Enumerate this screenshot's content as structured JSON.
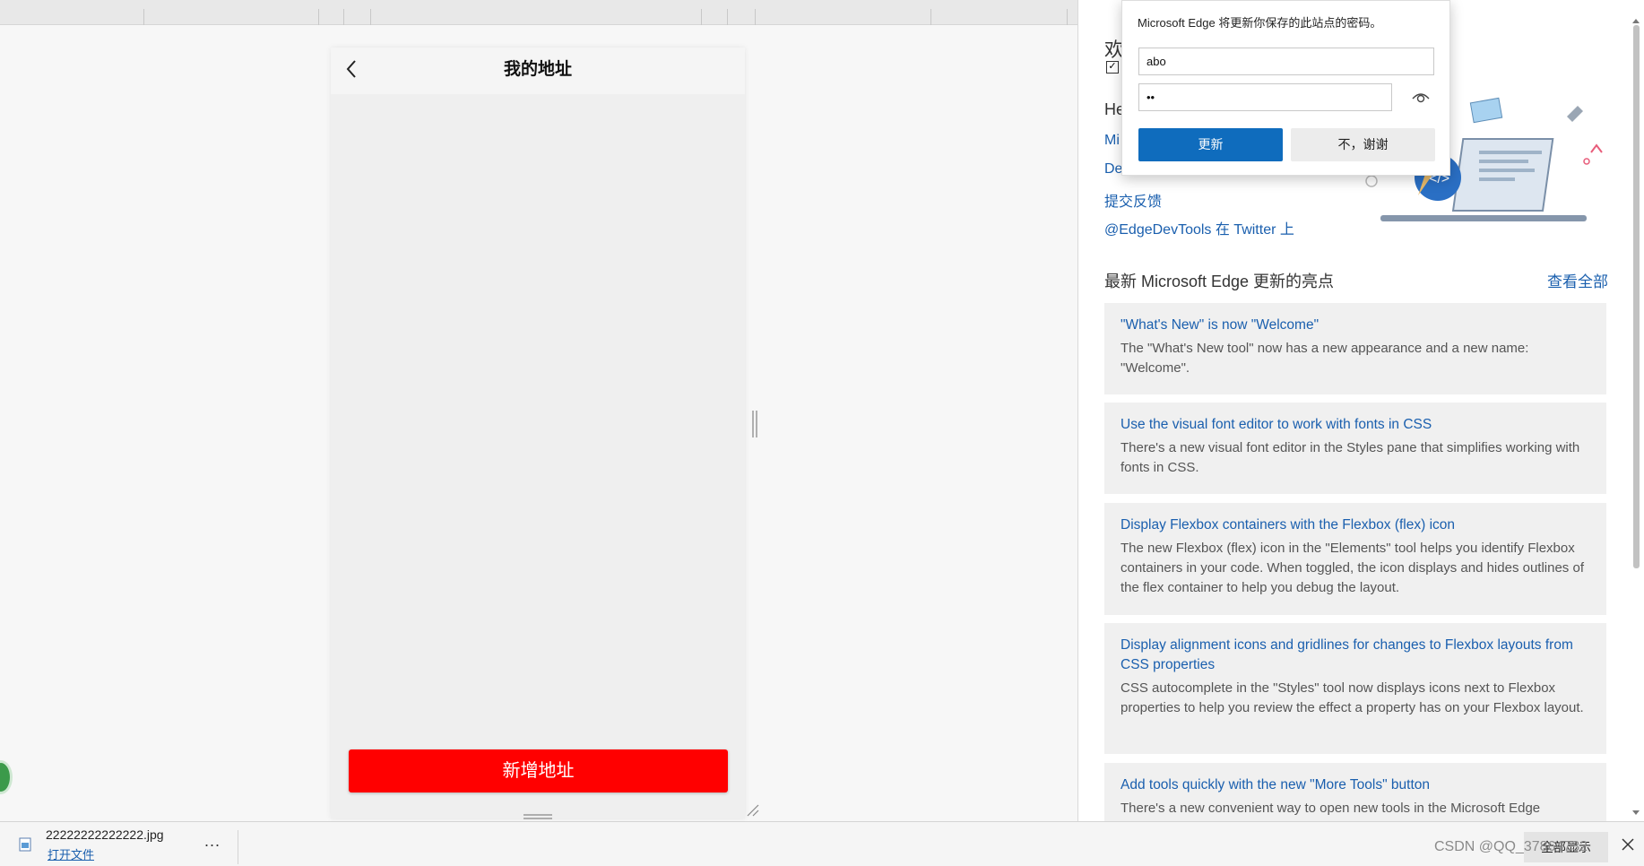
{
  "device": {
    "title": "我的地址",
    "add_button": "新增地址"
  },
  "devtools": {
    "partial_heading": "欢",
    "partial_he": "He",
    "partial_links": [
      "Mi",
      "De"
    ],
    "links": [
      "提交反馈",
      "@EdgeDevTools 在 Twitter 上"
    ],
    "section_title": "最新 Microsoft Edge 更新的亮点",
    "view_all": "查看全部",
    "cards": [
      {
        "title": "\"What's New\" is now \"Welcome\"",
        "desc": "The \"What's New tool\" now has a new appearance and a new name: \"Welcome\"."
      },
      {
        "title": "Use the visual font editor to work with fonts in CSS",
        "desc": "There's a new visual font editor in the Styles pane that simplifies working with fonts in CSS."
      },
      {
        "title": "Display Flexbox containers with the Flexbox (flex) icon",
        "desc": "The new Flexbox (flex) icon in the \"Elements\" tool helps you identify Flexbox containers in your code. When toggled, the icon displays and hides outlines of the flex container to help you debug the layout."
      },
      {
        "title": "Display alignment icons and gridlines for changes to Flexbox layouts from CSS properties",
        "desc": "CSS autocomplete in the \"Styles\" tool now displays icons next to Flexbox properties to help you review the effect a property has on your Flexbox layout."
      },
      {
        "title": "Add tools quickly with the new \"More Tools\" button",
        "desc": "There's a new convenient way to open new tools in the Microsoft Edge"
      }
    ]
  },
  "password_popup": {
    "message": "Microsoft Edge 将更新你保存的此站点的密码。",
    "username_value": "abo",
    "password_value": "••",
    "update_button": "更新",
    "no_thanks_button": "不，谢谢"
  },
  "download_bar": {
    "file_name": "22222222222222.jpg",
    "open_file": "打开文件",
    "more": "...",
    "show_all": "全部显示",
    "watermark": "CSDN @QQ_3​7​8​6​4​7​3​2"
  },
  "colors": {
    "accent_red": "#ff0000",
    "link_blue": "#1a5fae",
    "edge_blue": "#0f6cbd"
  }
}
